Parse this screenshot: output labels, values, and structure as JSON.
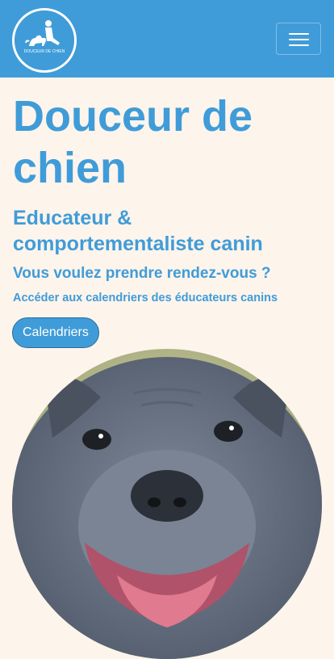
{
  "navbar": {
    "logo_text": "DOUCEUR DE CHIEN",
    "menu_icon": "hamburger-menu-icon",
    "color": "#3f9cd8"
  },
  "hero": {
    "title": "Douceur de chien",
    "subtitle": "Educateur & comportementaliste canin",
    "question": "Vous voulez prendre rendez-vous ?",
    "access_text": "Accéder aux calendriers des éducateurs canins",
    "button_label": "Calendriers"
  },
  "colors": {
    "accent": "#3f9cd8",
    "background": "#fdf4ec"
  }
}
